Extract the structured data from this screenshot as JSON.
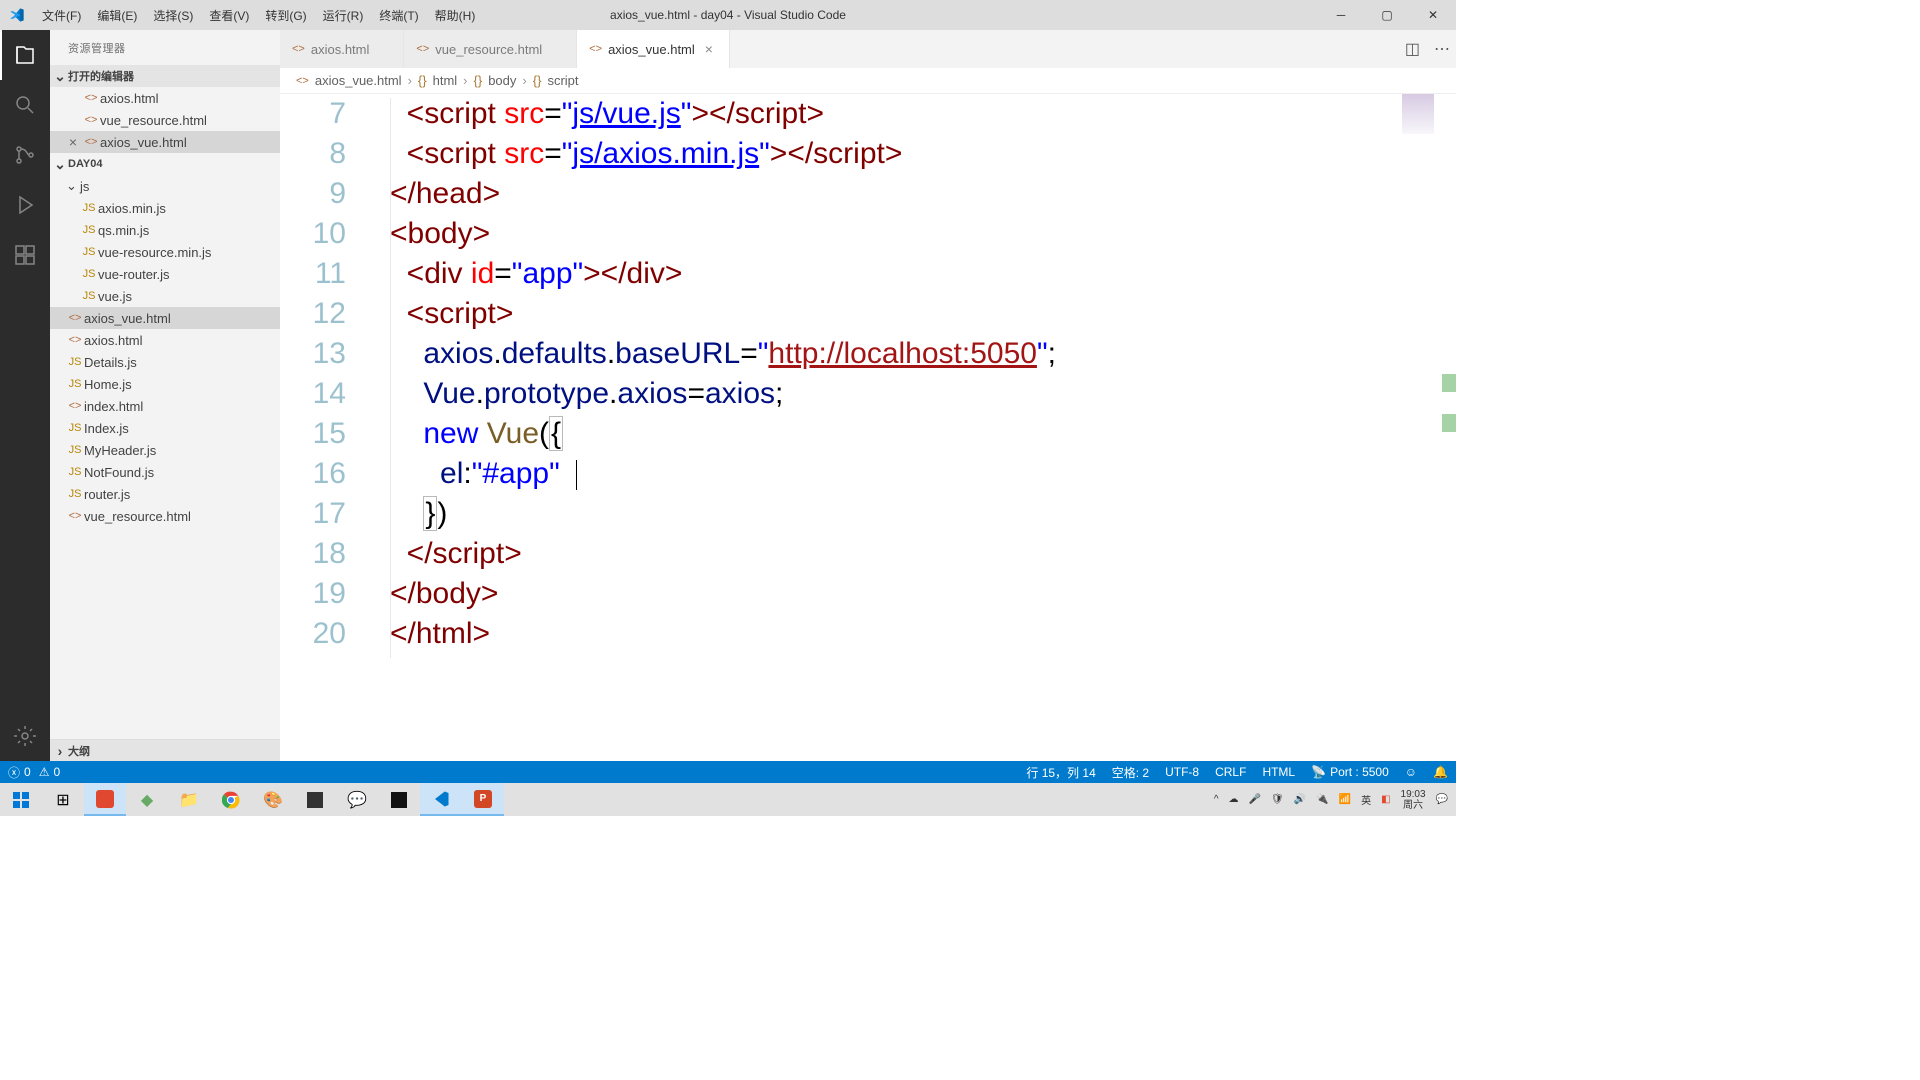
{
  "window": {
    "title": "axios_vue.html - day04 - Visual Studio Code"
  },
  "menu": [
    "文件(F)",
    "编辑(E)",
    "选择(S)",
    "查看(V)",
    "转到(G)",
    "运行(R)",
    "终端(T)",
    "帮助(H)"
  ],
  "sidebar": {
    "title": "资源管理器",
    "open_editors_label": "打开的编辑器",
    "open_editors": [
      {
        "name": "axios.html",
        "kind": "html",
        "closable": false
      },
      {
        "name": "vue_resource.html",
        "kind": "html",
        "closable": false
      },
      {
        "name": "axios_vue.html",
        "kind": "html",
        "closable": true,
        "selected": true
      }
    ],
    "folder": "DAY04",
    "tree": {
      "js_folder": "js",
      "js_files": [
        "axios.min.js",
        "qs.min.js",
        "vue-resource.min.js",
        "vue-router.js",
        "vue.js"
      ],
      "root_files": [
        {
          "name": "axios_vue.html",
          "kind": "html",
          "selected": true
        },
        {
          "name": "axios.html",
          "kind": "html"
        },
        {
          "name": "Details.js",
          "kind": "js"
        },
        {
          "name": "Home.js",
          "kind": "js"
        },
        {
          "name": "index.html",
          "kind": "html"
        },
        {
          "name": "Index.js",
          "kind": "js"
        },
        {
          "name": "MyHeader.js",
          "kind": "js"
        },
        {
          "name": "NotFound.js",
          "kind": "js"
        },
        {
          "name": "router.js",
          "kind": "js"
        },
        {
          "name": "vue_resource.html",
          "kind": "html"
        }
      ]
    },
    "outline_label": "大纲"
  },
  "tabs": [
    {
      "label": "axios.html",
      "active": false
    },
    {
      "label": "vue_resource.html",
      "active": false
    },
    {
      "label": "axios_vue.html",
      "active": true
    }
  ],
  "breadcrumb": {
    "file": "axios_vue.html",
    "path": [
      "html",
      "body",
      "script"
    ]
  },
  "code": {
    "first_line_no": 7,
    "lines": [
      {
        "n": 7,
        "indent": 2,
        "html": "<span class='c-punct'>&lt;</span><span class='c-tag'>script</span> <span class='c-attr'>src</span><span class='c-plain'>=</span><span class='c-str'>\"</span><span class='c-link'>js/vue.js</span><span class='c-str'>\"</span><span class='c-punct'>&gt;&lt;/</span><span class='c-tag'>script</span><span class='c-punct'>&gt;</span>"
      },
      {
        "n": 8,
        "indent": 2,
        "html": "<span class='c-punct'>&lt;</span><span class='c-tag'>script</span> <span class='c-attr'>src</span><span class='c-plain'>=</span><span class='c-str'>\"</span><span class='c-link'>js/axios.min.js</span><span class='c-str'>\"</span><span class='c-punct'>&gt;&lt;/</span><span class='c-tag'>script</span><span class='c-punct'>&gt;</span>"
      },
      {
        "n": 9,
        "indent": 0,
        "html": "<span class='c-punct'>&lt;/</span><span class='c-tag'>head</span><span class='c-punct'>&gt;</span>"
      },
      {
        "n": 10,
        "indent": 0,
        "html": "<span class='c-punct'>&lt;</span><span class='c-tag'>body</span><span class='c-punct'>&gt;</span>"
      },
      {
        "n": 11,
        "indent": 2,
        "html": "<span class='c-punct'>&lt;</span><span class='c-tag'>div</span> <span class='c-attr'>id</span><span class='c-plain'>=</span><span class='c-str'>\"app\"</span><span class='c-punct'>&gt;&lt;/</span><span class='c-tag'>div</span><span class='c-punct'>&gt;</span>"
      },
      {
        "n": 12,
        "indent": 2,
        "html": "<span class='c-punct'>&lt;</span><span class='c-tag'>script</span><span class='c-punct'>&gt;</span>"
      },
      {
        "n": 13,
        "indent": 4,
        "html": "<span class='c-id'>axios</span><span class='c-plain'>.</span><span class='c-id'>defaults</span><span class='c-plain'>.</span><span class='c-id'>baseURL</span><span class='c-plain'>=</span><span class='c-str'>\"</span><span class='c-link' style='color:#a31515;text-decoration-color:#a31515'>http://localhost:5050</span><span class='c-str'>\"</span><span class='c-plain'>;</span>"
      },
      {
        "n": 14,
        "indent": 4,
        "html": "<span class='c-id'>Vue</span><span class='c-plain'>.</span><span class='c-id'>prototype</span><span class='c-plain'>.</span><span class='c-id'>axios</span><span class='c-plain'>=</span><span class='c-id'>axios</span><span class='c-plain'>;</span>"
      },
      {
        "n": 15,
        "indent": 4,
        "html": "<span class='c-kw'>new</span> <span class='c-fn'>Vue</span><span class='c-plain'>(</span><span class='c-plain bracket-box' style='padding:0 1px'>{</span>"
      },
      {
        "n": 16,
        "indent": 6,
        "html": "<span class='c-id'>el</span><span class='c-plain'>:</span><span class='c-str'>\"#app\"</span>  <span class='cursor'></span>"
      },
      {
        "n": 17,
        "indent": 4,
        "html": "<span class='c-plain bracket-box' style='padding:0 1px'>}</span><span class='c-plain'>)</span>"
      },
      {
        "n": 18,
        "indent": 2,
        "html": "<span class='c-punct'>&lt;/</span><span class='c-tag'>script</span><span class='c-punct'>&gt;</span>"
      },
      {
        "n": 19,
        "indent": 0,
        "html": "<span class='c-punct'>&lt;/</span><span class='c-tag'>body</span><span class='c-punct'>&gt;</span>"
      },
      {
        "n": 20,
        "indent": 0,
        "html": "<span class='c-punct'>&lt;/</span><span class='c-tag'>html</span><span class='c-punct'>&gt;</span>"
      }
    ]
  },
  "statusbar": {
    "errors": "0",
    "warnings": "0",
    "cursor": "行 15，列 14",
    "spaces": "空格: 2",
    "encoding": "UTF-8",
    "eol": "CRLF",
    "lang": "HTML",
    "port": "Port : 5500"
  },
  "tray": {
    "time": "19:03",
    "date": "周六"
  }
}
